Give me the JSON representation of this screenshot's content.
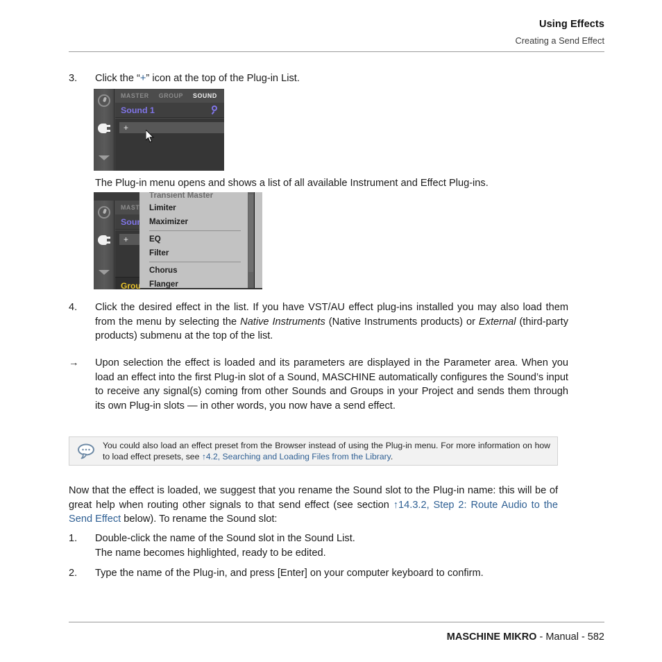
{
  "header": {
    "title": "Using Effects",
    "subtitle": "Creating a Send Effect"
  },
  "steps": {
    "step3": {
      "number": "3.",
      "text_before": "Click the “",
      "plus": "+",
      "text_after": "” icon at the top of the Plug-in List."
    },
    "caption1": "The Plug-in menu opens and shows a list of all available Instrument and Effect Plug-ins.",
    "step4": {
      "number": "4.",
      "part1": "Click the desired effect in the list. If you have VST/AU effect plug-ins installed you may also load them from the menu by selecting the ",
      "italic1": "Native Instruments",
      "part2": " (Native Instruments products) or ",
      "italic2": "External",
      "part3": " (third-party products) submenu at the top of the list."
    },
    "result": {
      "arrow": "→",
      "text": "Upon selection the effect is loaded and its parameters are displayed in the Parameter area. When you load an effect into the first Plug-in slot of a Sound, MASCHINE automatically configures the Sound’s input to receive any signal(s) coming from other Sounds and Groups in your Project and sends them through its own Plug-in slots — in other words, you now have a send effect."
    },
    "step1": {
      "number": "1.",
      "line1": "Double-click the name of the Sound slot in the Sound List.",
      "line2": "The name becomes highlighted, ready to be edited."
    },
    "step2": {
      "number": "2.",
      "text": "Type the name of the Plug-in, and press [Enter] on your computer keyboard to confirm."
    }
  },
  "tipbox": {
    "icon": "speech-bubble-icon",
    "text_before": "You could also load an effect preset from the Browser instead of using the Plug-in menu. For more information on how to load effect presets, see ",
    "link": "↑4.2, Searching and Loading Files from the Library",
    "text_after": "."
  },
  "paragraph": {
    "part1": "Now that the effect is loaded, we suggest that you rename the Sound slot to the Plug-in name: this will be of great help when routing other signals to that send effect (see section ",
    "link": "↑14.3.2, Step 2: Route Audio to the Send Effect",
    "part2": " below). To rename the Sound slot:"
  },
  "screenshot1": {
    "tabs": [
      {
        "label": "MASTER",
        "active": false
      },
      {
        "label": "GROUP",
        "active": false
      },
      {
        "label": "SOUND",
        "active": true
      }
    ],
    "slot_name": "Sound 1",
    "search_icon": "magnifier-icon",
    "knob_icon": "knob-icon",
    "plug_icon": "plug-icon",
    "collapse_icon": "chevron-down-icon",
    "plugin_add": "+",
    "cursor": "mouse-pointer-icon"
  },
  "screenshot2": {
    "tabs": [
      {
        "label": "MASTE",
        "active": false
      }
    ],
    "slot_name": "Soun",
    "plugin_add": "+",
    "cursor": "mouse-pointer-icon",
    "yellow_label": "Grou",
    "menu_items": [
      {
        "label": "Transient Master",
        "clipped": true
      },
      {
        "label": "Limiter",
        "clipped": false
      },
      {
        "label": "Maximizer",
        "clipped": false
      },
      {
        "separator": true
      },
      {
        "label": "EQ",
        "clipped": false
      },
      {
        "label": "Filter",
        "clipped": false
      },
      {
        "separator": true
      },
      {
        "label": "Chorus",
        "clipped": false
      },
      {
        "label": "Flanger",
        "clipped": false
      }
    ]
  },
  "footer": {
    "product": "MASCHINE MIKRO",
    "rest": " - Manual - 582"
  },
  "colors": {
    "link": "#2e5f93",
    "accent_purple": "#8075e8",
    "accent_yellow": "#e8c22a",
    "tip_bg": "#f2f2f2",
    "screenshot_bg": "#4a4a4a"
  }
}
